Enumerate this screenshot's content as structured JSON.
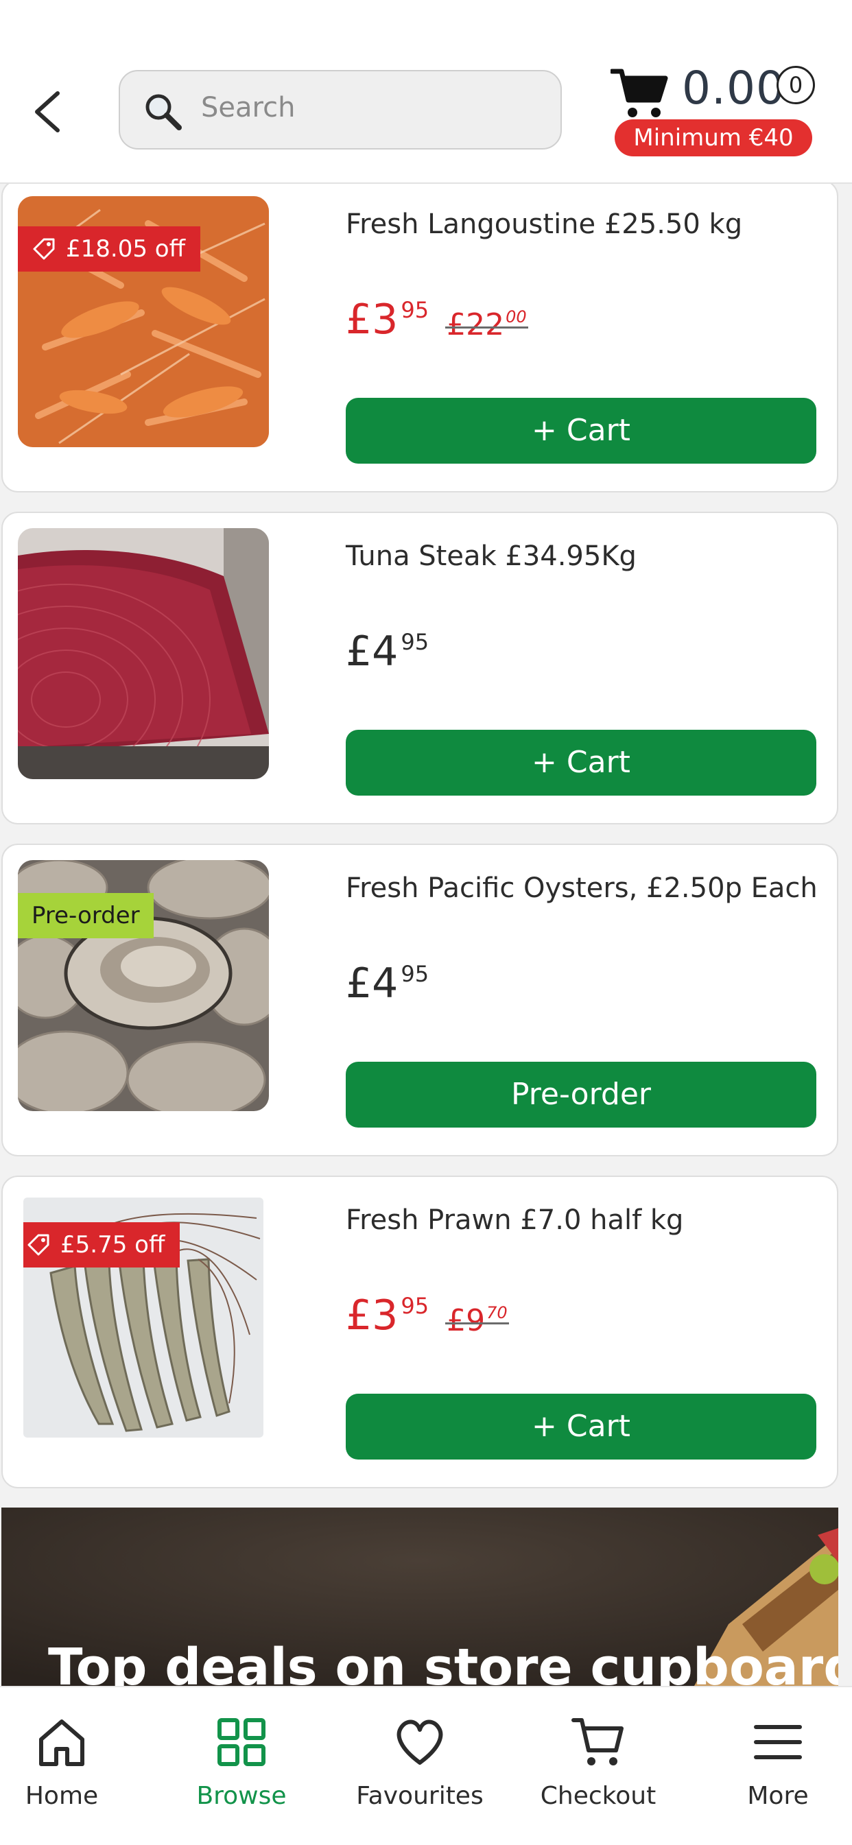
{
  "header": {
    "search_placeholder": "Search",
    "cart_total": "0.00",
    "cart_count": "0",
    "minimum_label": "Minimum €40"
  },
  "products": [
    {
      "title": "Fresh Langoustine £25.50 kg",
      "badge": "£18.05 off",
      "price_main": "£3",
      "price_cents": "95",
      "old_main": "£22",
      "old_cents": "00",
      "button": "+ Cart",
      "image": "langoustines"
    },
    {
      "title": "Tuna Steak £34.95Kg",
      "price_main": "£4",
      "price_cents": "95",
      "button": "+ Cart",
      "image": "tuna-steak"
    },
    {
      "title": "Fresh Pacific Oysters, £2.50p Each",
      "badge": "Pre-order",
      "price_main": "£4",
      "price_cents": "95",
      "button": "Pre-order",
      "image": "oysters"
    },
    {
      "title": "Fresh Prawn £7.0 half kg",
      "badge": "£5.75 off",
      "price_main": "£3",
      "price_cents": "95",
      "old_main": "£9",
      "old_cents": "70",
      "button": "+ Cart",
      "image": "prawns"
    }
  ],
  "banner": {
    "title": "Top deals on store cupboard"
  },
  "nav": [
    {
      "label": "Home",
      "icon": "home-icon"
    },
    {
      "label": "Browse",
      "icon": "grid-icon",
      "active": true
    },
    {
      "label": "Favourites",
      "icon": "heart-icon"
    },
    {
      "label": "Checkout",
      "icon": "cart-icon"
    },
    {
      "label": "More",
      "icon": "menu-icon"
    }
  ],
  "colors": {
    "brand_green": "#0f8a3f",
    "sale_red": "#d9262b",
    "preorder_green": "#a6d33a",
    "active_nav": "#12934a"
  }
}
